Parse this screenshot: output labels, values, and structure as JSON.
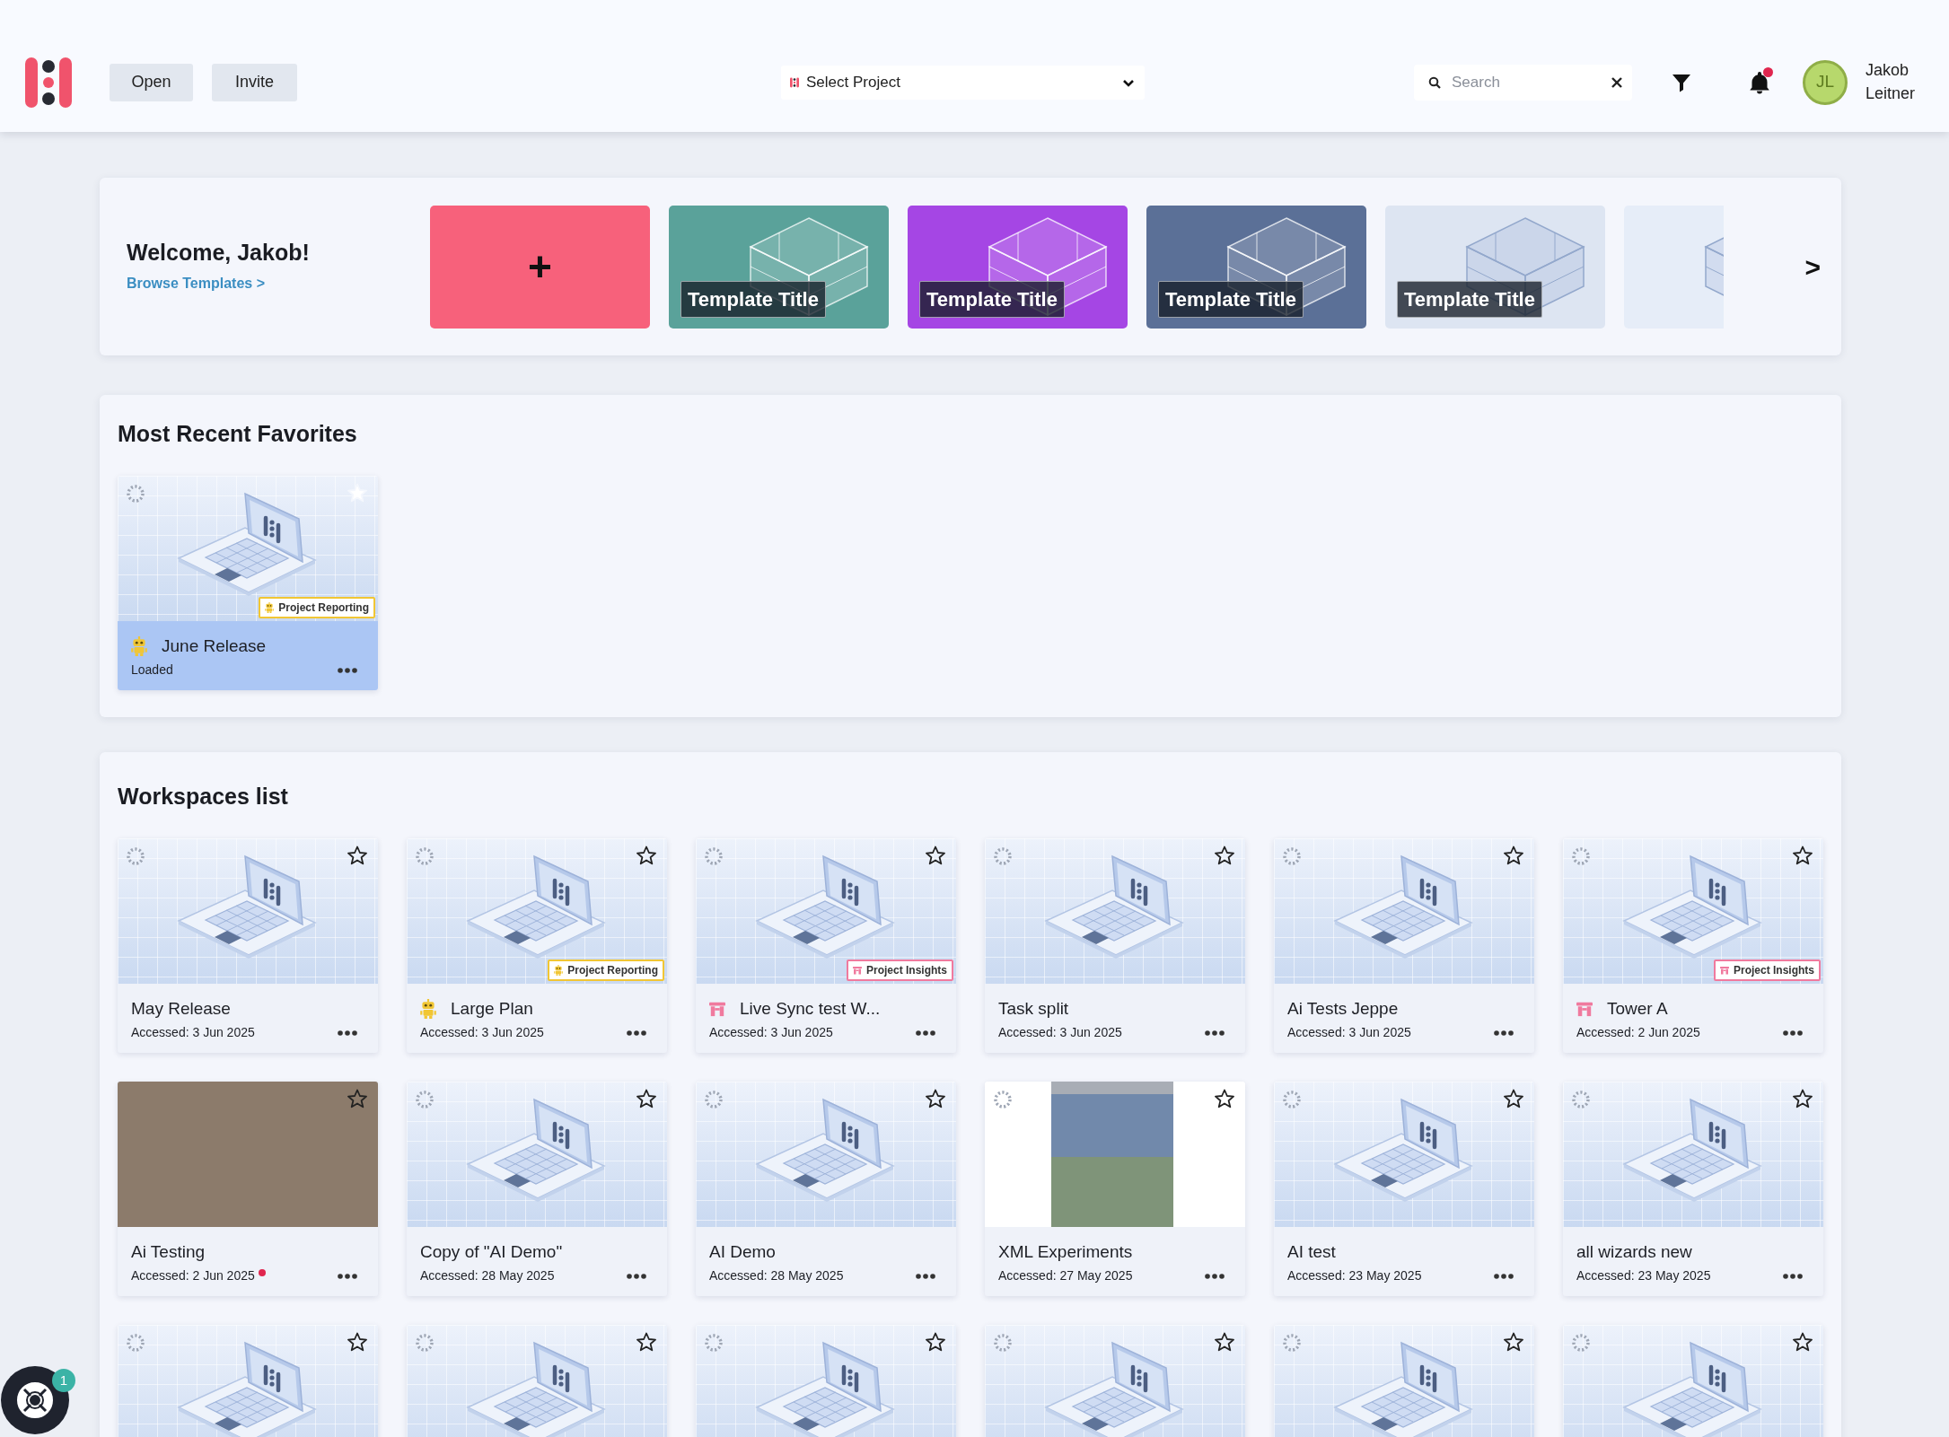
{
  "header": {
    "buttons": [
      "Open",
      "Invite"
    ],
    "project_select": {
      "label": "Select Project"
    },
    "search": {
      "placeholder": "Search"
    },
    "notifications": {
      "unread": true
    },
    "user": {
      "initials": "JL",
      "name": "Jakob Leitner"
    }
  },
  "welcome": {
    "greeting": "Welcome, Jakob!",
    "link": "Browse Templates >",
    "templates": [
      {
        "kind": "add",
        "label": "+",
        "color": "#f7617b"
      },
      {
        "kind": "template",
        "title": "Template Title",
        "color": "#5aa29a"
      },
      {
        "kind": "template",
        "title": "Template Title",
        "color": "#a546e4"
      },
      {
        "kind": "template",
        "title": "Template Title",
        "color": "#5b7097"
      },
      {
        "kind": "template",
        "title": "Template Title",
        "color": "#dde5f2"
      },
      {
        "kind": "template",
        "color": "#e6edf8"
      }
    ],
    "next": ">"
  },
  "favorites": {
    "title": "Most Recent Favorites",
    "items": [
      {
        "kind": "laptop",
        "name": "June Release",
        "status": "Loaded",
        "tag": {
          "kind": "reporting",
          "label": "Project Reporting"
        },
        "starred": true,
        "loading": true,
        "selected": true
      }
    ]
  },
  "workspaces": {
    "title": "Workspaces list",
    "items": [
      {
        "kind": "laptop",
        "name": "May Release",
        "status": "Accessed: 3 Jun 2025",
        "starred": false,
        "loading": true,
        "selected": false,
        "alert": false
      },
      {
        "kind": "laptop",
        "name": "Large Plan",
        "status": "Accessed: 3 Jun 2025",
        "tag": {
          "kind": "reporting",
          "label": "Project Reporting"
        },
        "starred": false,
        "loading": true,
        "selected": false,
        "alert": false
      },
      {
        "kind": "laptop",
        "name": "Live Sync test W...",
        "status": "Accessed: 3 Jun 2025",
        "tag": {
          "kind": "insights",
          "label": "Project Insights"
        },
        "starred": false,
        "loading": true,
        "selected": false,
        "alert": false
      },
      {
        "kind": "laptop",
        "name": "Task split",
        "status": "Accessed: 3 Jun 2025",
        "starred": false,
        "loading": true,
        "selected": false,
        "alert": false
      },
      {
        "kind": "laptop",
        "name": "Ai Tests Jeppe",
        "status": "Accessed: 3 Jun 2025",
        "starred": false,
        "loading": true,
        "selected": false,
        "alert": false
      },
      {
        "kind": "laptop",
        "name": "Tower A",
        "status": "Accessed: 2 Jun 2025",
        "tag": {
          "kind": "insights",
          "label": "Project Insights"
        },
        "starred": false,
        "loading": true,
        "selected": false,
        "alert": false
      },
      {
        "kind": "photo",
        "name": "Ai Testing",
        "status": "Accessed: 2 Jun 2025",
        "starred": false,
        "loading": false,
        "selected": false,
        "alert": true
      },
      {
        "kind": "laptop",
        "name": "Copy of \"AI Demo\"",
        "status": "Accessed: 28 May 2025",
        "starred": false,
        "loading": true,
        "selected": false,
        "alert": false
      },
      {
        "kind": "laptop",
        "name": "AI Demo",
        "status": "Accessed: 28 May 2025",
        "starred": false,
        "loading": true,
        "selected": false,
        "alert": false
      },
      {
        "kind": "table",
        "name": "XML Experiments",
        "status": "Accessed: 27 May 2025",
        "starred": false,
        "loading": true,
        "selected": false,
        "alert": false
      },
      {
        "kind": "laptop",
        "name": "AI test",
        "status": "Accessed: 23 May 2025",
        "starred": false,
        "loading": true,
        "selected": false,
        "alert": false
      },
      {
        "kind": "laptop",
        "name": "all wizards new",
        "status": "Accessed: 23 May 2025",
        "starred": false,
        "loading": true,
        "selected": false,
        "alert": false
      },
      {
        "kind": "laptop",
        "starred": false,
        "loading": true
      },
      {
        "kind": "laptop",
        "starred": false,
        "loading": true
      },
      {
        "kind": "laptop",
        "starred": false,
        "loading": true
      },
      {
        "kind": "laptop",
        "starred": false,
        "loading": true
      },
      {
        "kind": "laptop",
        "starred": false,
        "loading": true
      },
      {
        "kind": "laptop",
        "starred": false,
        "loading": true
      }
    ]
  },
  "help": {
    "count": "1"
  }
}
